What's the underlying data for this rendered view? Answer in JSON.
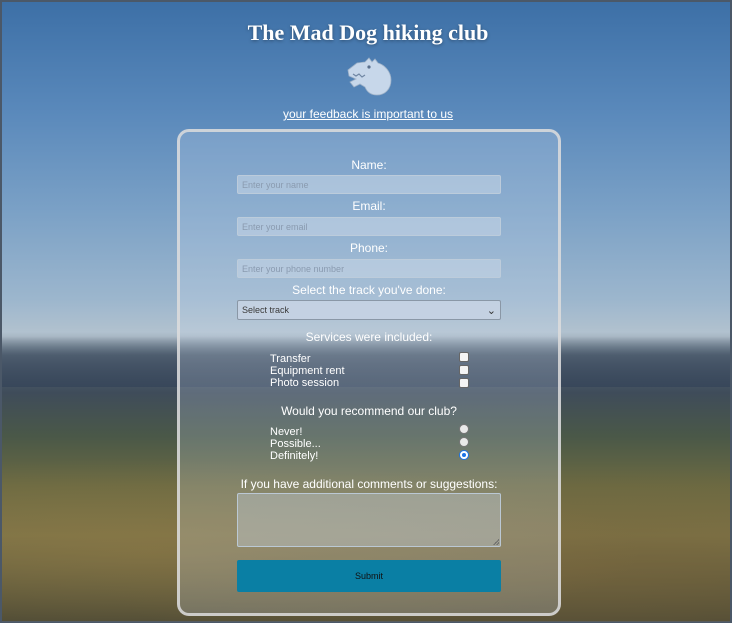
{
  "header": {
    "title": "The Mad Dog hiking club",
    "logo_icon": "dog-head-icon",
    "subtitle_link": "your feedback is important to us"
  },
  "form": {
    "name_label": "Name:",
    "name_placeholder": "Enter your name",
    "email_label": "Email:",
    "email_placeholder": "Enter your email",
    "phone_label": "Phone:",
    "phone_placeholder": "Enter your phone number",
    "track_label": "Select the track you've done:",
    "track_selected": "Select track",
    "services_label": "Services were included:",
    "services": [
      {
        "label": "Transfer",
        "checked": false
      },
      {
        "label": "Equipment rent",
        "checked": false
      },
      {
        "label": "Photo session",
        "checked": false
      }
    ],
    "recommend_label": "Would you recommend our club?",
    "recommend_options": [
      {
        "label": "Never!",
        "selected": false
      },
      {
        "label": "Possible...",
        "selected": false
      },
      {
        "label": "Definitely!",
        "selected": true
      }
    ],
    "comments_label": "If you have additional comments or suggestions:",
    "submit_label": "Submit"
  },
  "colors": {
    "accent": "#0a7fa4",
    "radio_selected": "#1a73e8"
  }
}
